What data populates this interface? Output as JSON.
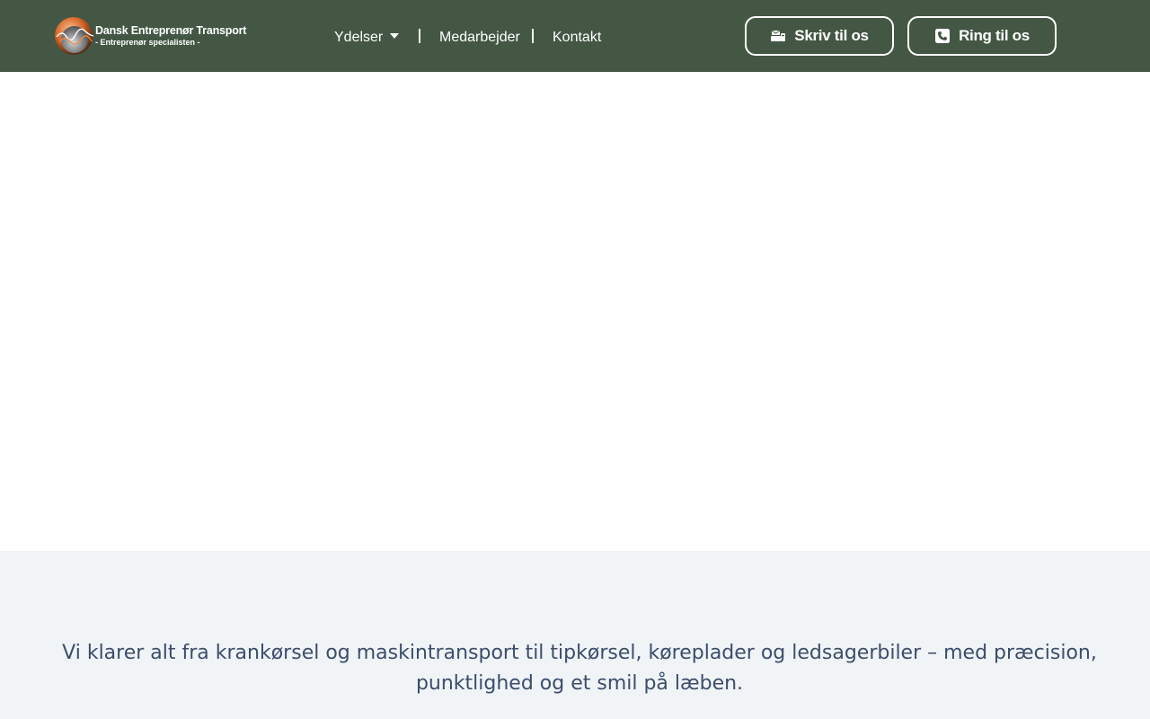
{
  "header": {
    "background_color": "#435744",
    "logo": {
      "title": "Dansk Entreprenør Transport",
      "subtitle": "- Entreprenør specialisten -",
      "icon": "logo-globe-icon"
    },
    "nav": {
      "items": [
        {
          "label": "Ydelser",
          "has_dropdown": true,
          "icon": "caret-down-icon"
        },
        {
          "label": "Medarbejder",
          "has_dropdown": false
        },
        {
          "label": "Kontakt",
          "has_dropdown": false
        }
      ]
    },
    "cta_buttons": [
      {
        "label": "Skriv til os",
        "icon": "mail-icon"
      },
      {
        "label": "Ring til os",
        "icon": "phone-icon"
      }
    ]
  },
  "intro": {
    "background_color": "#f0f4f7",
    "text_color": "#3c4d6b",
    "text": "Vi klarer alt fra krankørsel og maskintransport til tipkørsel, køreplader og ledsagerbiler – med præcision, punktlighed og et smil på læben."
  }
}
